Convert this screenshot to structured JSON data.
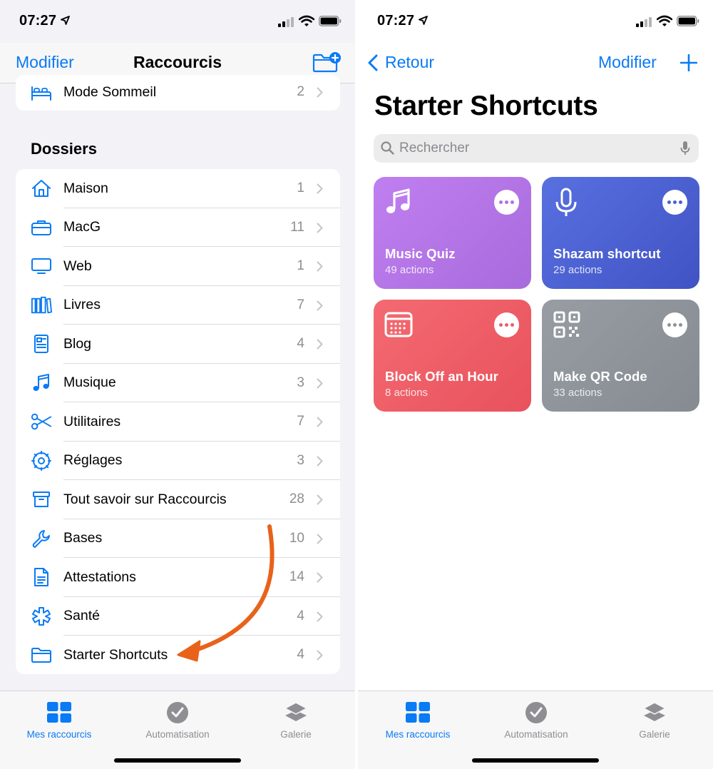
{
  "colors": {
    "accent": "#0a7af5",
    "annotation_arrow": "#e8621a",
    "tile_music": "#b46ee6",
    "tile_shazam": "#4a5fd0",
    "tile_block": "#ef5d66",
    "tile_qr": "#8c9298"
  },
  "left": {
    "status": {
      "time": "07:27"
    },
    "nav": {
      "edit": "Modifier",
      "title": "Raccourcis",
      "new_folder_icon": "folder-plus-icon"
    },
    "top_row": {
      "label": "Mode Sommeil",
      "count": "2",
      "icon": "bed-icon"
    },
    "section_title": "Dossiers",
    "folders": [
      {
        "label": "Maison",
        "count": "1",
        "icon": "house-icon"
      },
      {
        "label": "MacG",
        "count": "11",
        "icon": "briefcase-icon"
      },
      {
        "label": "Web",
        "count": "1",
        "icon": "display-icon"
      },
      {
        "label": "Livres",
        "count": "7",
        "icon": "books-icon"
      },
      {
        "label": "Blog",
        "count": "4",
        "icon": "newspaper-icon"
      },
      {
        "label": "Musique",
        "count": "3",
        "icon": "music-note-icon"
      },
      {
        "label": "Utilitaires",
        "count": "7",
        "icon": "scissors-icon"
      },
      {
        "label": "Réglages",
        "count": "3",
        "icon": "gear-icon"
      },
      {
        "label": "Tout savoir sur Raccourcis",
        "count": "28",
        "icon": "archive-box-icon"
      },
      {
        "label": "Bases",
        "count": "10",
        "icon": "wrench-icon"
      },
      {
        "label": "Attestations",
        "count": "14",
        "icon": "document-icon"
      },
      {
        "label": "Santé",
        "count": "4",
        "icon": "medical-star-icon"
      },
      {
        "label": "Starter Shortcuts",
        "count": "4",
        "icon": "folder-icon"
      }
    ],
    "tabs": [
      {
        "label": "Mes raccourcis",
        "icon": "grid-icon",
        "active": true
      },
      {
        "label": "Automatisation",
        "icon": "clock-check-icon",
        "active": false
      },
      {
        "label": "Galerie",
        "icon": "layers-icon",
        "active": false
      }
    ]
  },
  "right": {
    "status": {
      "time": "07:27"
    },
    "nav": {
      "back": "Retour",
      "edit": "Modifier",
      "add_icon": "plus-icon"
    },
    "title": "Starter Shortcuts",
    "search": {
      "placeholder": "Rechercher"
    },
    "shortcuts": [
      {
        "name": "Music Quiz",
        "subtitle": "49 actions",
        "icon": "music-note-icon"
      },
      {
        "name": "Shazam shortcut",
        "subtitle": "29 actions",
        "icon": "microphone-icon"
      },
      {
        "name": "Block Off an Hour",
        "subtitle": "8 actions",
        "icon": "calendar-icon"
      },
      {
        "name": "Make QR Code",
        "subtitle": "33 actions",
        "icon": "qr-code-icon"
      }
    ],
    "tabs": [
      {
        "label": "Mes raccourcis",
        "icon": "grid-icon",
        "active": true
      },
      {
        "label": "Automatisation",
        "icon": "clock-check-icon",
        "active": false
      },
      {
        "label": "Galerie",
        "icon": "layers-icon",
        "active": false
      }
    ]
  }
}
